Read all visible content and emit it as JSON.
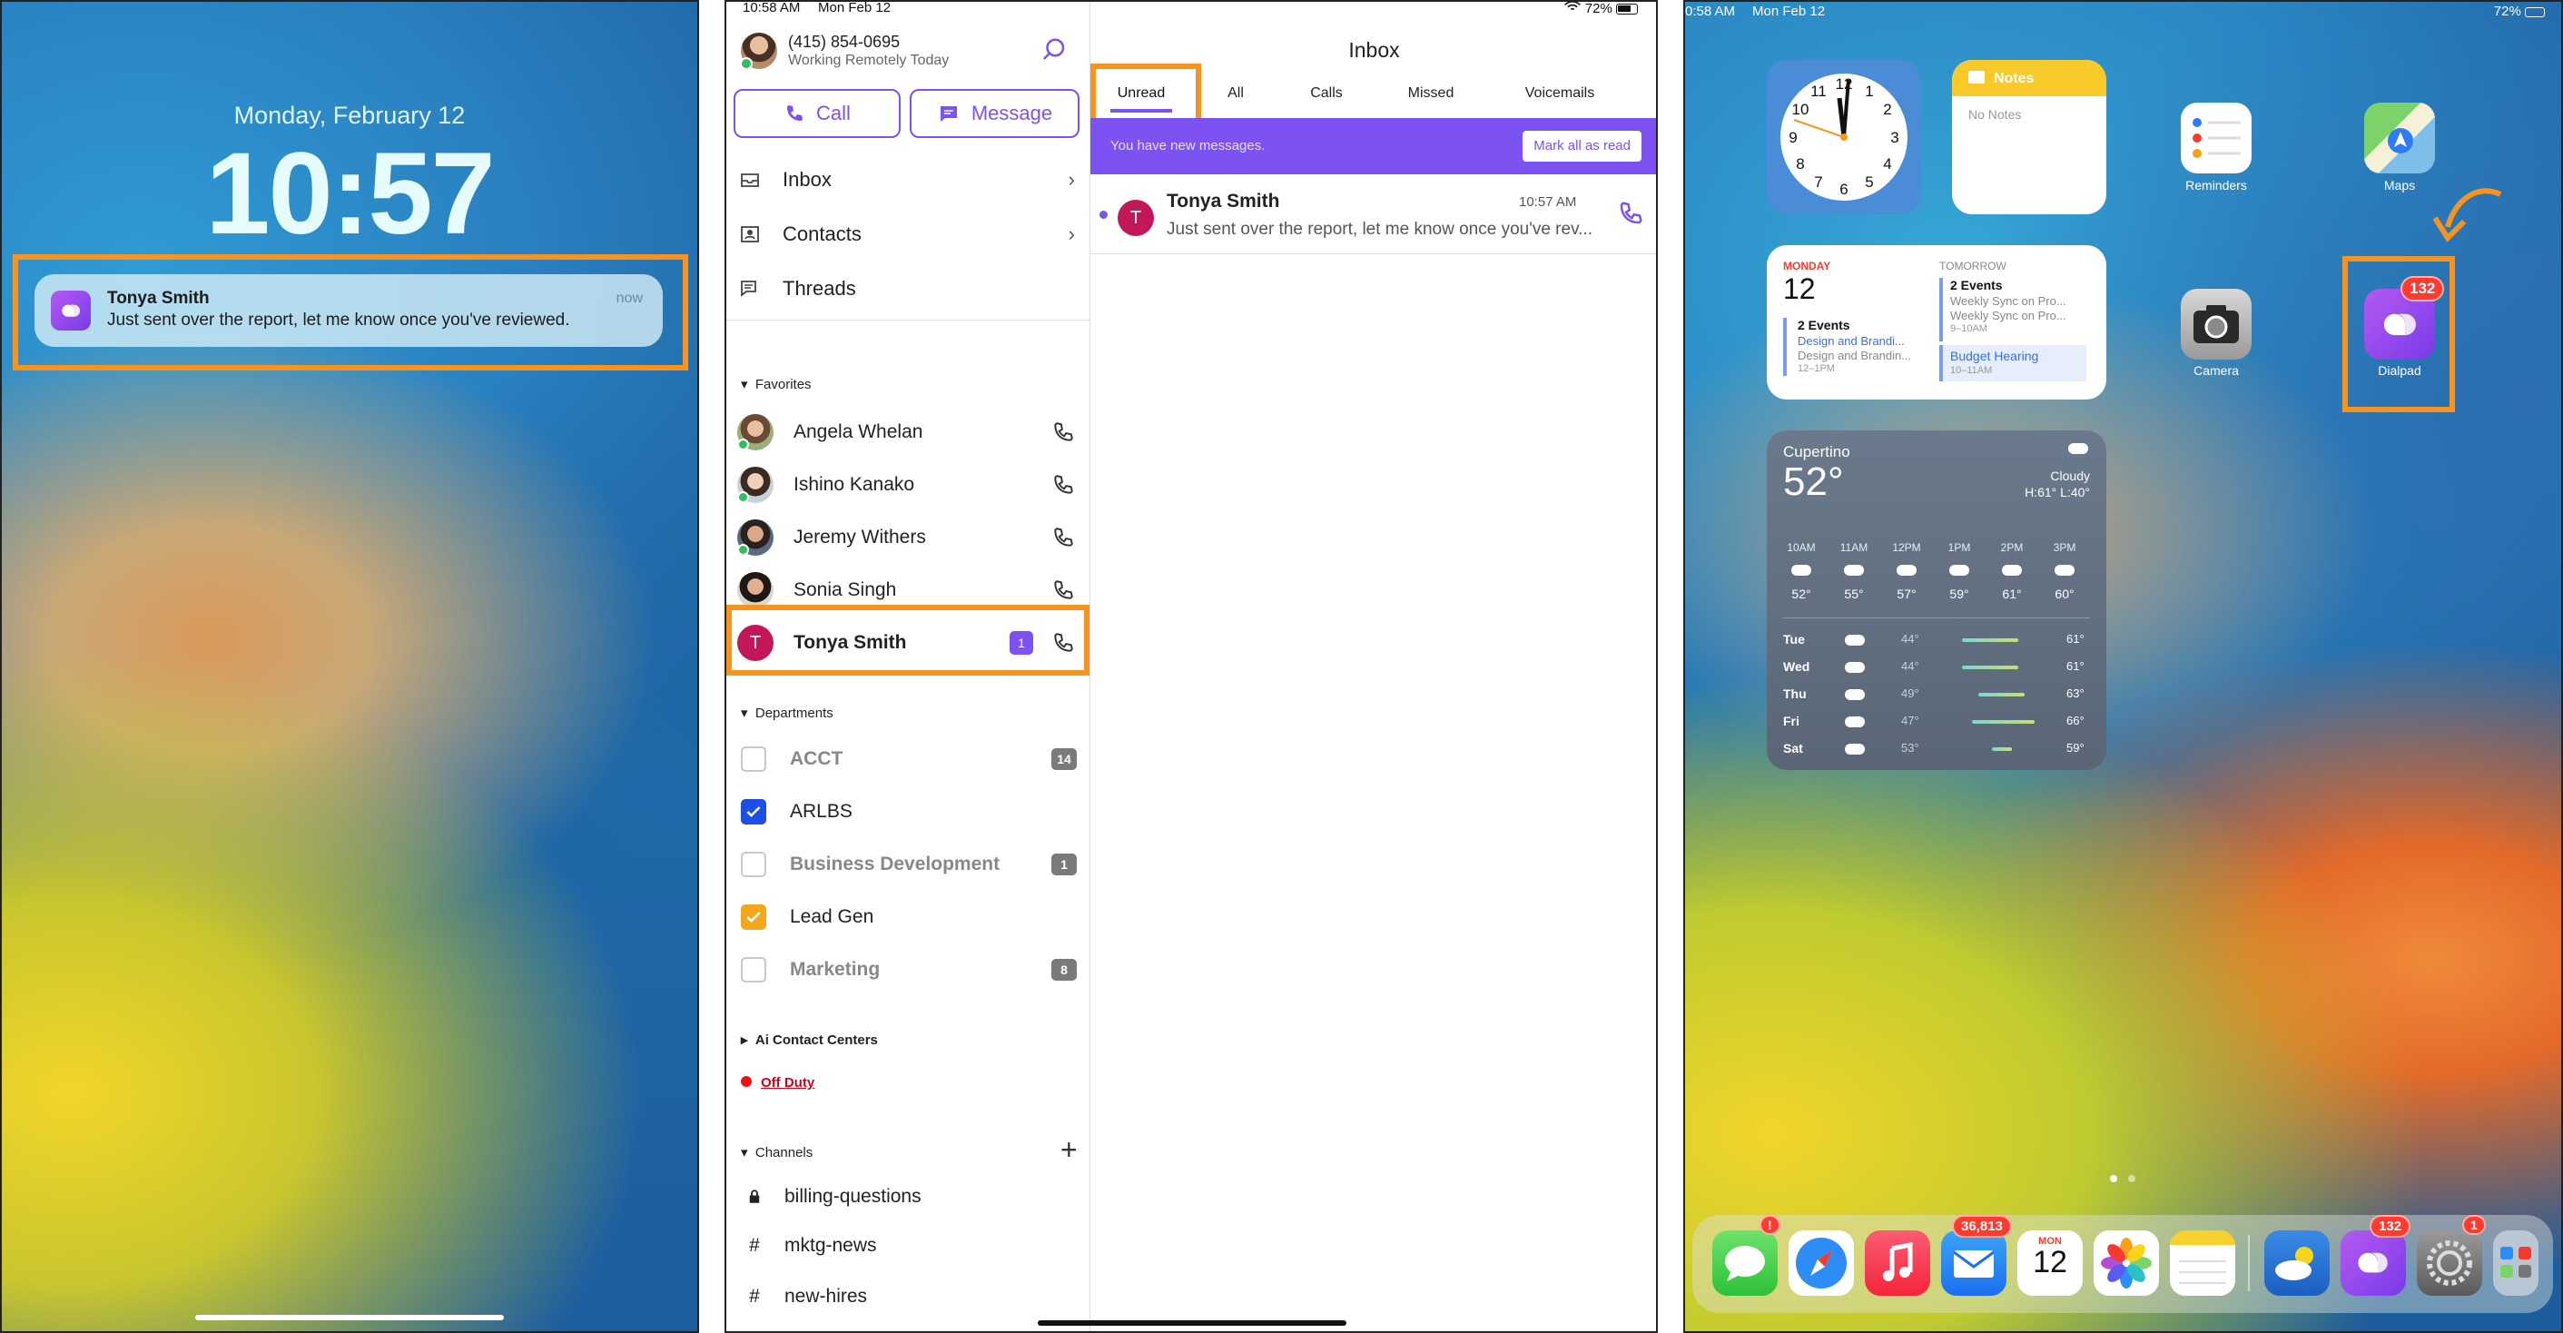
{
  "lock_screen": {
    "date": "Monday, February 12",
    "time": "10:57",
    "notification": {
      "sender": "Tonya Smith",
      "message": "Just sent over the report, let me know once you've reviewed.",
      "time": "now"
    }
  },
  "app": {
    "status_time": "10:58 AM",
    "status_date": "Mon Feb 12",
    "battery": "72%",
    "user": {
      "phone": "(415) 854-0695",
      "status": "Working Remotely Today"
    },
    "call_label": "Call",
    "message_label": "Message",
    "nav": [
      "Inbox",
      "Contacts",
      "Threads"
    ],
    "favorites_title": "Favorites",
    "favorites": [
      "Angela Whelan",
      "Ishino Kanako",
      "Jeremy Withers",
      "Sonia  Singh",
      "Tonya Smith"
    ],
    "tonya_initial": "T",
    "tonya_unread": "1",
    "departments_title": "Departments",
    "departments": [
      {
        "name": "ACCT",
        "count": "14",
        "checked": false,
        "color": ""
      },
      {
        "name": "ARLBS",
        "count": "",
        "checked": true,
        "color": "#1d4ee8"
      },
      {
        "name": "Business Development",
        "count": "1",
        "checked": false,
        "color": ""
      },
      {
        "name": "Lead Gen",
        "count": "",
        "checked": true,
        "color": "#f2a81d"
      },
      {
        "name": "Marketing",
        "count": "8",
        "checked": false,
        "color": ""
      }
    ],
    "ai_contact_centers": "Ai Contact Centers",
    "off_duty": "Off Duty",
    "channels_title": "Channels",
    "channels": [
      {
        "sym": "lock",
        "name": "billing-questions"
      },
      {
        "sym": "#",
        "name": "mktg-news"
      },
      {
        "sym": "#",
        "name": "new-hires"
      }
    ],
    "inbox": {
      "title": "Inbox",
      "tabs": [
        "Unread",
        "All",
        "Calls",
        "Missed",
        "Voicemails"
      ],
      "banner": "You have new messages.",
      "mark_all": "Mark all as read",
      "msg": {
        "initial": "T",
        "name": "Tonya Smith",
        "time": "10:57 AM",
        "preview": "Just sent over the report, let me know once you've rev..."
      }
    }
  },
  "home": {
    "status_time": "0:58 AM",
    "status_date": "Mon Feb 12",
    "battery": "72%",
    "notes": {
      "title": "Notes",
      "body": "No Notes"
    },
    "calendar": {
      "day_label": "MONDAY",
      "day": "12",
      "events": "2 Events",
      "e1": "Design and Brandi...",
      "e1b": "Design and Brandin...",
      "e1t": "12–1PM",
      "tomorrow": "TOMORROW",
      "t_events": "2 Events",
      "t1": "Weekly Sync on Pro...",
      "t2": "Weekly Sync on Pro...",
      "t2t": "9–10AM",
      "t3": "Budget Hearing",
      "t3t": "10–11AM"
    },
    "weather": {
      "city": "Cupertino",
      "temp": "52°",
      "cond": "Cloudy",
      "hilo": "H:61° L:40°",
      "hours": [
        {
          "t": "10AM",
          "v": "52°"
        },
        {
          "t": "11AM",
          "v": "55°"
        },
        {
          "t": "12PM",
          "v": "57°"
        },
        {
          "t": "1PM",
          "v": "59°"
        },
        {
          "t": "2PM",
          "v": "61°"
        },
        {
          "t": "3PM",
          "v": "60°"
        }
      ],
      "days": [
        {
          "d": "Tue",
          "lo": "44°",
          "hi": "61°"
        },
        {
          "d": "Wed",
          "lo": "44°",
          "hi": "61°"
        },
        {
          "d": "Thu",
          "lo": "49°",
          "hi": "63°"
        },
        {
          "d": "Fri",
          "lo": "47°",
          "hi": "66°"
        },
        {
          "d": "Sat",
          "lo": "53°",
          "hi": "59°"
        }
      ]
    },
    "icons": {
      "reminders": "Reminders",
      "maps": "Maps",
      "camera": "Camera",
      "dialpad": "Dialpad"
    },
    "dialpad_badge": "132",
    "dock_badges": {
      "messages": "!",
      "mail": "36,813",
      "dialpad": "132",
      "settings": "1"
    },
    "cal_dock": {
      "mon": "MON",
      "day": "12"
    }
  },
  "colors": {
    "accent": "#7c52f0",
    "highlight": "#f7931e",
    "avatar_red": "#c2185b"
  }
}
